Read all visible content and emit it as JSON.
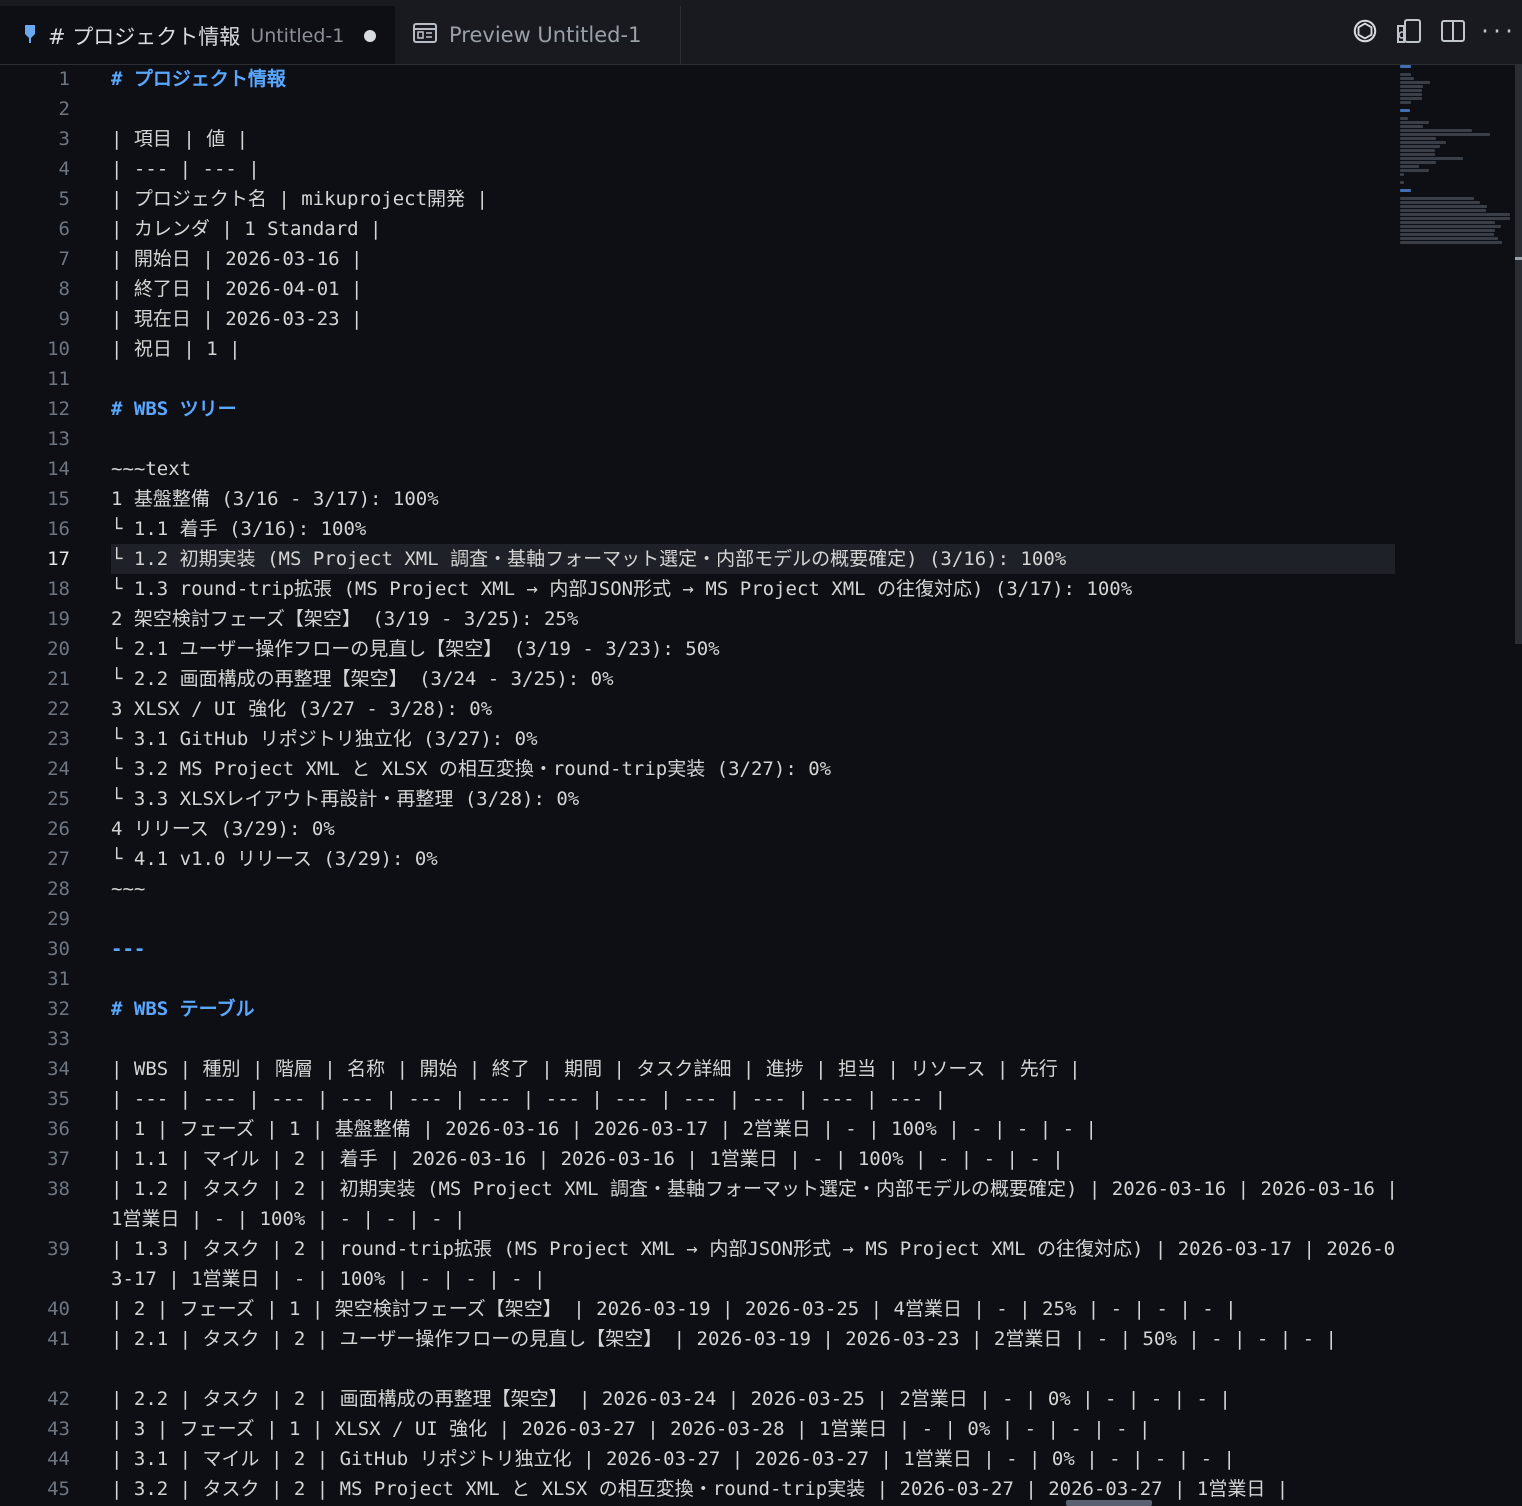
{
  "tabs": [
    {
      "label": "# プロジェクト情報",
      "description": "Untitled-1",
      "dirty": true,
      "active": true,
      "icon": "markdown-pin-icon"
    },
    {
      "label": "Preview Untitled-1",
      "active": false,
      "icon": "preview-icon"
    }
  ],
  "toolbar": {
    "icons": [
      "openai-icon",
      "open-preview-to-side-icon",
      "split-editor-icon",
      "more-actions-icon"
    ]
  },
  "editor": {
    "current_line": 17,
    "lines": [
      {
        "n": 1,
        "text": "# プロジェクト情報",
        "kind": "heading"
      },
      {
        "n": 2,
        "text": ""
      },
      {
        "n": 3,
        "text": "| 項目 | 値 |"
      },
      {
        "n": 4,
        "text": "| --- | --- |"
      },
      {
        "n": 5,
        "text": "| プロジェクト名 | mikuproject開発 |"
      },
      {
        "n": 6,
        "text": "| カレンダ | 1 Standard |"
      },
      {
        "n": 7,
        "text": "| 開始日 | 2026-03-16 |"
      },
      {
        "n": 8,
        "text": "| 終了日 | 2026-04-01 |"
      },
      {
        "n": 9,
        "text": "| 現在日 | 2026-03-23 |"
      },
      {
        "n": 10,
        "text": "| 祝日 | 1 |"
      },
      {
        "n": 11,
        "text": ""
      },
      {
        "n": 12,
        "text": "# WBS ツリー",
        "kind": "heading"
      },
      {
        "n": 13,
        "text": ""
      },
      {
        "n": 14,
        "text": "~~~text"
      },
      {
        "n": 15,
        "text": "1 基盤整備 (3/16 - 3/17): 100%"
      },
      {
        "n": 16,
        "text": "└ 1.1 着手 (3/16): 100%"
      },
      {
        "n": 17,
        "text": "└ 1.2 初期実装 (MS Project XML 調査・基軸フォーマット選定・内部モデルの概要確定) (3/16): 100%"
      },
      {
        "n": 18,
        "text": "└ 1.3 round-trip拡張 (MS Project XML → 内部JSON形式 → MS Project XML の往復対応) (3/17): 100%"
      },
      {
        "n": 19,
        "text": "2 架空検討フェーズ【架空】 (3/19 - 3/25): 25%"
      },
      {
        "n": 20,
        "text": "└ 2.1 ユーザー操作フローの見直し【架空】 (3/19 - 3/23): 50%"
      },
      {
        "n": 21,
        "text": "└ 2.2 画面構成の再整理【架空】 (3/24 - 3/25): 0%"
      },
      {
        "n": 22,
        "text": "3 XLSX / UI 強化 (3/27 - 3/28): 0%"
      },
      {
        "n": 23,
        "text": "└ 3.1 GitHub リポジトリ独立化 (3/27): 0%"
      },
      {
        "n": 24,
        "text": "└ 3.2 MS Project XML と XLSX の相互変換・round-trip実装 (3/27): 0%"
      },
      {
        "n": 25,
        "text": "└ 3.3 XLSXレイアウト再設計・再整理 (3/28): 0%"
      },
      {
        "n": 26,
        "text": "4 リリース (3/29): 0%"
      },
      {
        "n": 27,
        "text": "└ 4.1 v1.0 リリース (3/29): 0%"
      },
      {
        "n": 28,
        "text": "~~~"
      },
      {
        "n": 29,
        "text": ""
      },
      {
        "n": 30,
        "text": "---",
        "kind": "rule"
      },
      {
        "n": 31,
        "text": ""
      },
      {
        "n": 32,
        "text": "# WBS テーブル",
        "kind": "heading"
      },
      {
        "n": 33,
        "text": ""
      },
      {
        "n": 34,
        "text": "| WBS | 種別 | 階層 | 名称 | 開始 | 終了 | 期間 | タスク詳細 | 進捗 | 担当 | リソース | 先行 |"
      },
      {
        "n": 35,
        "text": "| --- | --- | --- | --- | --- | --- | --- | --- | --- | --- | --- | --- |"
      },
      {
        "n": 36,
        "text": "| 1 | フェーズ | 1 | 基盤整備 | 2026-03-16 | 2026-03-17 | 2営業日 | - | 100% | - | - | - |"
      },
      {
        "n": 37,
        "text": "| 1.1 | マイル | 2 | 着手 | 2026-03-16 | 2026-03-16 | 1営業日 | - | 100% | - | - | - |"
      },
      {
        "n": 38,
        "text": "| 1.2 | タスク | 2 | 初期実装 (MS Project XML 調査・基軸フォーマット選定・内部モデルの概要確定) | 2026-03-16 | 2026-03-16 | 1営業日 | - | 100% | - | - | - |",
        "wrap": true
      },
      {
        "n": 39,
        "text": "| 1.3 | タスク | 2 | round-trip拡張 (MS Project XML → 内部JSON形式 → MS Project XML の往復対応) | 2026-03-17 | 2026-03-17 | 1営業日 | - | 100% | - | - | - |",
        "wrap": true
      },
      {
        "n": 40,
        "text": "| 2 | フェーズ | 1 | 架空検討フェーズ【架空】 | 2026-03-19 | 2026-03-25 | 4営業日 | - | 25% | - | - | - |"
      },
      {
        "n": 41,
        "text": "| 2.1 | タスク | 2 | ユーザー操作フローの見直し【架空】 | 2026-03-19 | 2026-03-23 | 2営業日 | - | 50% | - | - | - |",
        "wrap": true
      },
      {
        "n": 42,
        "text": "| 2.2 | タスク | 2 | 画面構成の再整理【架空】 | 2026-03-24 | 2026-03-25 | 2営業日 | - | 0% | - | - | - |"
      },
      {
        "n": 43,
        "text": "| 3 | フェーズ | 1 | XLSX / UI 強化 | 2026-03-27 | 2026-03-28 | 1営業日 | - | 0% | - | - | - |"
      },
      {
        "n": 44,
        "text": "| 3.1 | マイル | 2 | GitHub リポジトリ独立化 | 2026-03-27 | 2026-03-27 | 1営業日 | - | 0% | - | - | - |"
      },
      {
        "n": 45,
        "text": "| 3.2 | タスク | 2 | MS Project XML と XLSX の相互変換・round-trip実装 | 2026-03-27 | 2026-03-27 | 1営業日 |"
      }
    ]
  }
}
